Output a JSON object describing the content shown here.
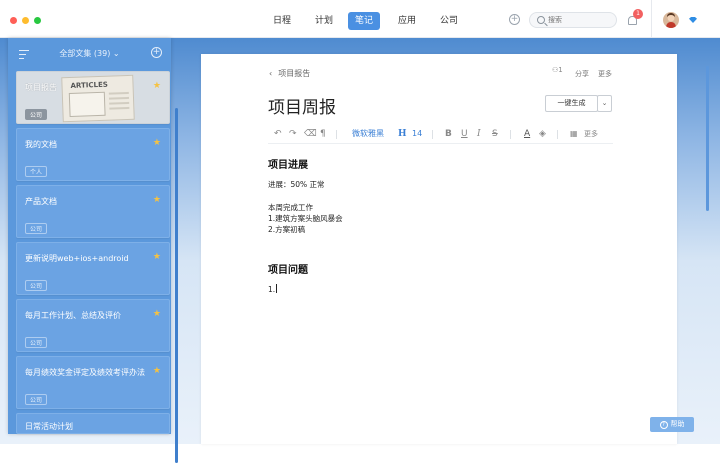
{
  "window_controls": {
    "close_color": "#ff5f57",
    "minimize_color": "#febc2e",
    "maximize_color": "#28c840"
  },
  "topnav": {
    "items": [
      {
        "label": "日程",
        "active": false
      },
      {
        "label": "计划",
        "active": false
      },
      {
        "label": "笔记",
        "active": true
      },
      {
        "label": "应用",
        "active": false
      },
      {
        "label": "公司",
        "active": false
      }
    ],
    "search_placeholder": "搜索",
    "notification_count": "1",
    "accent_color": "#4a90e2"
  },
  "sidebar": {
    "title": "全部文集 (39)",
    "cards": [
      {
        "title": "项目报告",
        "tag": "公司",
        "starred": true,
        "selected": true,
        "thumbnail_title": "ARTICLES"
      },
      {
        "title": "我的文档",
        "tag": "个人",
        "starred": true,
        "selected": false
      },
      {
        "title": "产品文档",
        "tag": "公司",
        "starred": true,
        "selected": false
      },
      {
        "title": "更新说明web+ios+android",
        "tag": "公司",
        "starred": true,
        "selected": false
      },
      {
        "title": "每月工作计划、总结及评价",
        "tag": "公司",
        "starred": true,
        "selected": false
      },
      {
        "title": "每月绩效奖金评定及绩效考评办法",
        "tag": "公司",
        "starred": true,
        "selected": false
      },
      {
        "title": "日常活动计划",
        "tag": "",
        "starred": false,
        "selected": false
      }
    ]
  },
  "editor": {
    "breadcrumb": "项目报告",
    "collaborators": "1",
    "share_label": "分享",
    "more_label": "更多",
    "doc_title": "项目周报",
    "generate_label": "一键生成",
    "toolbar": {
      "font_name": "微软雅黑",
      "heading_label": "H",
      "font_size": "14",
      "more_label": "更多"
    },
    "sections": [
      {
        "heading": "项目进展",
        "lines": [
          "进展：50% 正常",
          "",
          "本周完成工作",
          "1.建筑方案头脑风暴会",
          "2.方案初稿"
        ]
      },
      {
        "heading": "项目问题",
        "lines": [
          "1."
        ]
      }
    ]
  },
  "help_label": "帮助"
}
